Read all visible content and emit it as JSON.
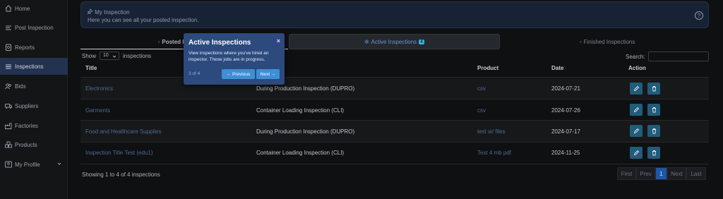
{
  "sidebar": {
    "items": [
      {
        "label": "Home",
        "icon": "home-icon"
      },
      {
        "label": "Post Inspection",
        "icon": "list-icon"
      },
      {
        "label": "Reports",
        "icon": "report-icon"
      },
      {
        "label": "Inspections",
        "icon": "list-icon",
        "active": true
      },
      {
        "label": "Bids",
        "icon": "users-icon"
      },
      {
        "label": "Suppliers",
        "icon": "truck-icon"
      },
      {
        "label": "Factories",
        "icon": "factory-icon"
      },
      {
        "label": "Products",
        "icon": "boxes-icon"
      },
      {
        "label": "My Profile",
        "icon": "profile-icon"
      }
    ]
  },
  "banner": {
    "title": "My Inspection",
    "subtitle": "Here you can see all your posted inspection.",
    "help": "?"
  },
  "tabs": [
    {
      "label": "Posted I"
    },
    {
      "label": "Active Inspections",
      "badge": "4"
    },
    {
      "label": "Finished Inspections"
    }
  ],
  "controls": {
    "show_label": "Show",
    "show_value": "10",
    "show_suffix": "inspections",
    "search_label": "Search:"
  },
  "table": {
    "columns": [
      "Title",
      "Product",
      "Date",
      "Action"
    ],
    "rows": [
      {
        "title": "Electronics",
        "type": "During Production Inspection (DUPRO)",
        "product": "csv",
        "date": "2024-07-21"
      },
      {
        "title": "Garments",
        "type": "Container Loading Inspection (CLI)",
        "product": "csv",
        "date": "2024-07-26"
      },
      {
        "title": "Food and Healthcare Supplies",
        "type": "During Production Inspection (DUPRO)",
        "product": "test w/ files",
        "date": "2024-07-17"
      },
      {
        "title": "Inspection Title Test (edu1)",
        "type": "Container Loading Inspection (CLI)",
        "product": "Test 4 mb pdf",
        "date": "2024-11-25"
      }
    ]
  },
  "footer": {
    "showing": "Showing 1 to 4 of 4 inspections"
  },
  "pagination": [
    "First",
    "Prev",
    "1",
    "Next",
    "Last"
  ],
  "tour": {
    "title": "Active Inspections",
    "close": "×",
    "body": "View inspections where you've hired an inspector. These jobs are in progress.",
    "progress": "3 of 4",
    "prev": "← Previous",
    "next": "Next →"
  },
  "colors": {
    "accent": "#3bb0e0",
    "tour_bg": "#2c4a7e",
    "action_button": "#1f5d7a",
    "active_page": "#1f57a8"
  }
}
